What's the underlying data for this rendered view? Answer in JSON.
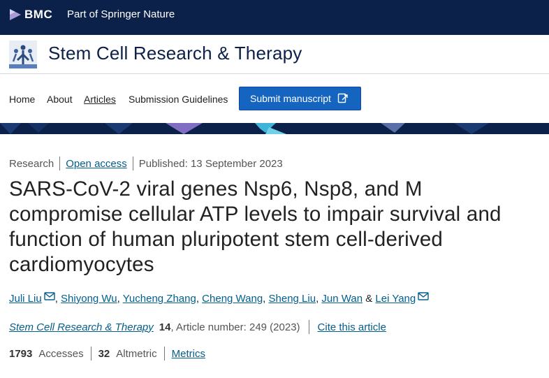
{
  "header": {
    "brand": "BMC",
    "tagline": "Part of Springer Nature",
    "brand_color": "#0b2149"
  },
  "journal": {
    "title": "Stem Cell Research & Therapy"
  },
  "nav": {
    "items": [
      {
        "label": "Home"
      },
      {
        "label": "About"
      },
      {
        "label": "Articles"
      },
      {
        "label": "Submission Guidelines"
      }
    ],
    "submit_label": "Submit manuscript"
  },
  "article": {
    "type": "Research",
    "access": "Open access",
    "published": "Published: 13 September 2023",
    "title": "SARS-CoV-2 viral genes Nsp6, Nsp8, and M compromise cellular ATP levels to impair survival and function of human pluripotent stem cell-derived cardiomyocytes",
    "authors": [
      {
        "name": "Juli Liu",
        "corresponding": true
      },
      {
        "name": "Shiyong Wu",
        "corresponding": false
      },
      {
        "name": "Yucheng Zhang",
        "corresponding": false
      },
      {
        "name": "Cheng Wang",
        "corresponding": false
      },
      {
        "name": "Sheng Liu",
        "corresponding": false
      },
      {
        "name": "Jun Wan",
        "corresponding": false
      },
      {
        "name": "Lei Yang",
        "corresponding": true
      }
    ],
    "citation": {
      "journal": "Stem Cell Research & Therapy",
      "volume": "14",
      "article_number": ", Article number: 249 (2023)",
      "cite_label": "Cite this article"
    },
    "metrics": {
      "accesses_value": "1793",
      "accesses_label": "Accesses",
      "altmetric_value": "32",
      "altmetric_label": "Altmetric",
      "metrics_link": "Metrics"
    }
  },
  "colors": {
    "link": "#025e8d",
    "button": "#1565c0"
  }
}
